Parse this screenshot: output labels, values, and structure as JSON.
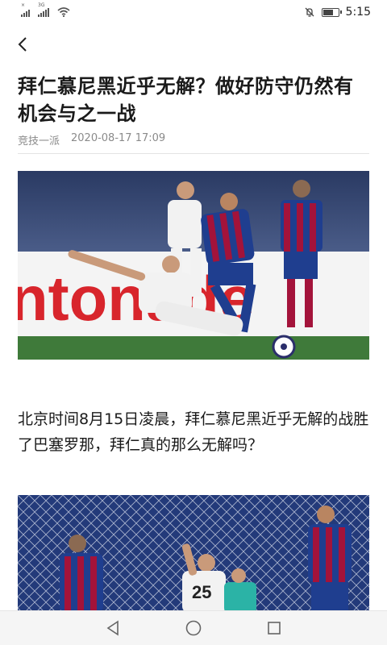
{
  "status_bar": {
    "signal1_tag": "×",
    "signal2_tag": "3G",
    "time": "5:15",
    "battery_level": 0.7
  },
  "nav": {
    "back_icon": "chevron-left-icon"
  },
  "article": {
    "title": "拜仁慕尼黑近乎无解？做好防守仍然有机会与之一战",
    "source": "竞技一派",
    "date": "2020-08-17 17:09",
    "paragraph1": "北京时间8月15日凌晨，拜仁慕尼黑近乎无解的战胜了巴塞罗那，拜仁真的那么无解吗？"
  },
  "system_nav": {
    "back": "triangle-back-icon",
    "home": "circle-home-icon",
    "recents": "square-recents-icon"
  },
  "colors": {
    "barca_blue": "#1f3e8f",
    "barca_red": "#a3133a",
    "pitch_green": "#3f7a3a",
    "bayern_white": "#f2f2f2"
  }
}
